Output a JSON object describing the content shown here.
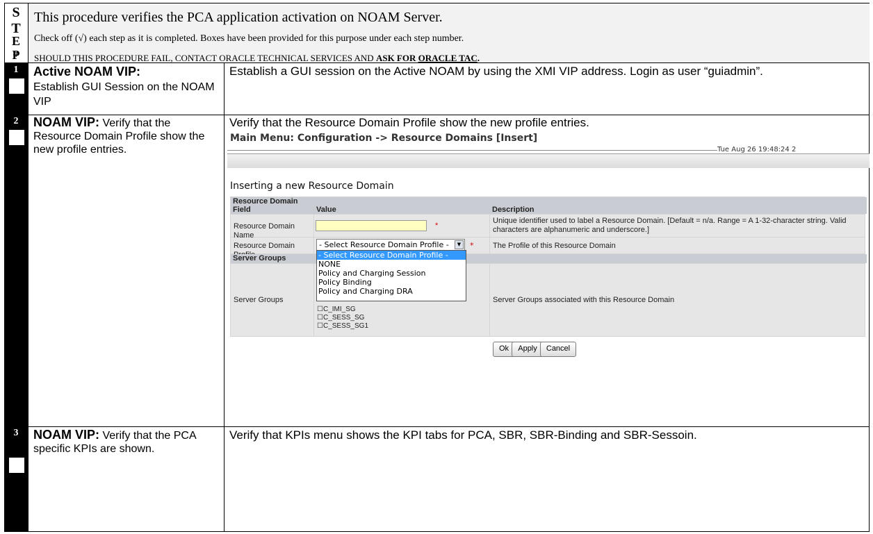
{
  "header": {
    "step_letters": [
      "S",
      "T",
      "E",
      "P",
      "#"
    ],
    "intro": "This procedure verifies the PCA application activation on NOAM Server.",
    "check_note": "Check off (√) each step as it is completed. Boxes have been provided for this purpose under each step number.",
    "fail_prefix": "SHOULD THIS PROCEDURE FAIL, CONTACT ORACLE TECHNICAL SERVICES AND ",
    "fail_bold": "ASK FOR ",
    "fail_underline": "ORACLE TAC",
    "fail_end": "."
  },
  "steps": [
    {
      "number": "1",
      "title_bold": "Active NOAM VIP:",
      "title_rest": "Establish GUI Session on the NOAM VIP",
      "description": "Establish a GUI session on the Active NOAM by using the XMI VIP address. Login as user “guiadmin”."
    },
    {
      "number": "2",
      "title_bold": "NOAM VIP:",
      "title_rest": " Verify that the Resource Domain Profile show the new profile entries.",
      "description": "Verify that the Resource Domain Profile show the new profile entries."
    },
    {
      "number": "3",
      "title_bold": "NOAM VIP:",
      "title_rest": " Verify that the PCA specific KPIs are shown.",
      "description": "Verify that KPIs menu shows the KPI tabs for PCA, SBR, SBR-Binding and SBR-Sessoin."
    }
  ],
  "screenshot": {
    "menu_title": "Main Menu: Configuration -> Resource Domains [Insert]",
    "timestamp": "Tue Aug 26 19:48:24 2",
    "heading": "Inserting a new Resource Domain",
    "section_resource_domain": "Resource Domain",
    "col_field": "Field",
    "col_value": "Value",
    "col_description": "Description",
    "name_label": "Resource Domain Name",
    "name_value": "",
    "name_description": "Unique identifier used to label a Resource Domain. [Default = n/a. Range = A 1-32-character string. Valid characters are alphanumeric and underscore.]",
    "profile_label": "Resource Domain Profile",
    "profile_selected": "- Select Resource Domain Profile -",
    "profile_description": "The Profile of this Resource Domain",
    "profile_options": [
      "- Select Resource Domain Profile -",
      "NONE",
      "Policy and Charging Session",
      "Policy Binding",
      "Policy and Charging DRA"
    ],
    "section_server_groups": "Server Groups",
    "server_groups_label": "Server Groups",
    "server_groups_description": "Server Groups associated with this Resource Domain",
    "server_group_items": [
      "C_IMI_SG",
      "C_SESS_SG",
      "C_SESS_SG1"
    ],
    "required_mark": "*",
    "buttons": {
      "ok": "Ok",
      "apply": "Apply",
      "cancel": "Cancel"
    }
  }
}
